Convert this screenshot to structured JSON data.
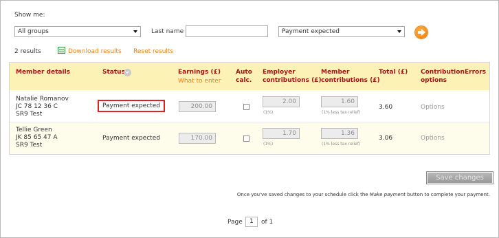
{
  "filters": {
    "show_me_label": "Show me:",
    "group_select": "All groups",
    "last_name_label": "Last name",
    "last_name_value": "",
    "status_select": "Payment expected"
  },
  "results": {
    "count_text": "2 results",
    "download_link": "Download results",
    "reset_link": "Reset results"
  },
  "table": {
    "headers": {
      "member_details": "Member details",
      "status": "Status",
      "earnings": "Earnings (£)",
      "earnings_sub": "What to enter",
      "auto_calc_1": "Auto",
      "auto_calc_2": "calc.",
      "employer_1": "Employer",
      "employer_2": "contributions (£)",
      "member_1": "Member",
      "member_2": "contributions (£)",
      "total": "Total (£)",
      "contribution_1": "Contribution",
      "contribution_2": "options",
      "errors": "Errors"
    },
    "rows": [
      {
        "name": "Natalie Romanov",
        "ni": "JC 78 12 36 C",
        "scheme": "SR9 Test",
        "status": "Payment expected",
        "earnings": "200.00",
        "employer": "2.00",
        "employer_hint": "(1%)",
        "member": "1.60",
        "member_hint": "(1% less tax relief)",
        "total": "3.60",
        "options": "Options"
      },
      {
        "name": "Tellie Green",
        "ni": "JK 85 65 47 A",
        "scheme": "SR9 Test",
        "status": "Payment expected",
        "earnings": "170.00",
        "employer": "1.70",
        "employer_hint": "(1%)",
        "member": "1.36",
        "member_hint": "(1% less tax relief)",
        "total": "3.06",
        "options": "Options"
      }
    ]
  },
  "footer": {
    "save_button": "Save changes",
    "note_before": "Once you've saved changes to your schedule click the ",
    "note_italic": "Make payment",
    "note_after": " button to complete your payment.",
    "page_label": "Page",
    "page_value": "1",
    "page_of": "of 1"
  },
  "colors": {
    "accent_orange": "#e8821c",
    "header_bg": "#fdf2b6",
    "header_text": "#a01818",
    "highlight_border": "#e0201a"
  },
  "icons": [
    "chevron-down-icon",
    "arrow-right-circle-icon",
    "spreadsheet-icon",
    "sort-chevron-icon"
  ]
}
